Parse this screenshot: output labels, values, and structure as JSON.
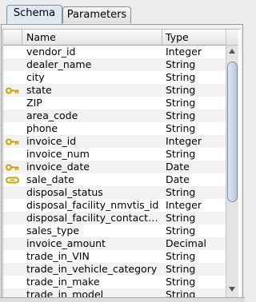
{
  "tabs": [
    {
      "label": "Schema",
      "active": true
    },
    {
      "label": "Parameters",
      "active": false
    }
  ],
  "table": {
    "columns": {
      "name": "Name",
      "type": "Type"
    },
    "rows": [
      {
        "name": "vendor_id",
        "type": "Integer",
        "icon": ""
      },
      {
        "name": "dealer_name",
        "type": "String",
        "icon": ""
      },
      {
        "name": "city",
        "type": "String",
        "icon": ""
      },
      {
        "name": "state",
        "type": "String",
        "icon": "key-icon"
      },
      {
        "name": "ZIP",
        "type": "String",
        "icon": ""
      },
      {
        "name": "area_code",
        "type": "String",
        "icon": ""
      },
      {
        "name": "phone",
        "type": "String",
        "icon": ""
      },
      {
        "name": "invoice_id",
        "type": "Integer",
        "icon": "key-icon"
      },
      {
        "name": "invoice_num",
        "type": "String",
        "icon": ""
      },
      {
        "name": "invoice_date",
        "type": "Date",
        "icon": "key-icon"
      },
      {
        "name": "sale_date",
        "type": "Date",
        "icon": "linked-key-icon"
      },
      {
        "name": "disposal_status",
        "type": "String",
        "icon": ""
      },
      {
        "name": "disposal_facility_nmvtis_id",
        "type": "Integer",
        "icon": ""
      },
      {
        "name": "disposal_facility_contact…",
        "type": "String",
        "icon": ""
      },
      {
        "name": "sales_type",
        "type": "String",
        "icon": ""
      },
      {
        "name": "invoice_amount",
        "type": "Decimal",
        "icon": ""
      },
      {
        "name": "trade_in_VIN",
        "type": "String",
        "icon": ""
      },
      {
        "name": "trade_in_vehicle_category",
        "type": "String",
        "icon": ""
      },
      {
        "name": "trade_in_make",
        "type": "String",
        "icon": ""
      },
      {
        "name": "trade_in_model",
        "type": "String",
        "icon": ""
      }
    ]
  },
  "colors": {
    "key_icon": "#c9a400",
    "tab_active": "#dfe8f3",
    "scroll_thumb": "#b6c7dd"
  }
}
